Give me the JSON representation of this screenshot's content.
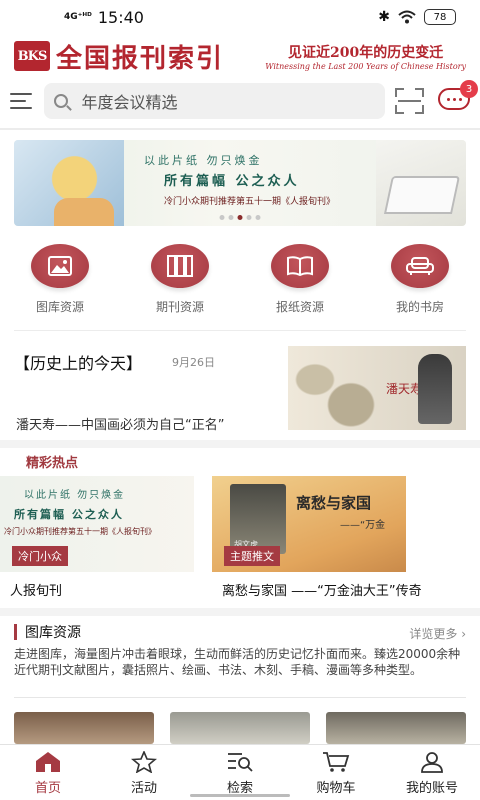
{
  "status_bar": {
    "network": "4G⁺ᴴᴰ",
    "time": "15:40",
    "battery": "78"
  },
  "header": {
    "logo_mark": "BKS",
    "title": "全国报刊索引",
    "slogan_main": "见证近200年的历史变迁",
    "slogan_sub": "Witnessing the Last 200 Years of Chinese History"
  },
  "search": {
    "placeholder": "年度会议精选",
    "message_badge": "3"
  },
  "banner": {
    "line1": "以此片纸   勿只焕金",
    "line2": "所有篇幅   公之众人",
    "line3": "冷门小众期刊推荐第五十一期《人报旬刊》",
    "active_slide": 3,
    "slide_count": 5
  },
  "categories": [
    {
      "label": "图库资源",
      "icon": "image-icon"
    },
    {
      "label": "期刊资源",
      "icon": "books-icon"
    },
    {
      "label": "报纸资源",
      "icon": "open-book-icon"
    },
    {
      "label": "我的书房",
      "icon": "sofa-icon"
    }
  ],
  "today": {
    "title": "【历史上的今天】",
    "date": "9月26日",
    "headline": "潘天寿——中国画必须为自己“正名”",
    "thumb_name": "潘天寿"
  },
  "hot": {
    "section_title": "精彩热点",
    "items": [
      {
        "tag": "冷门小众",
        "caption": "人报旬刊",
        "img_line1": "以此片纸   勿只焕金",
        "img_line2": "所有篇幅   公之众人",
        "img_line3": "冷门小众期刊推荐第五十一期《人报旬刊》"
      },
      {
        "tag": "主题推文",
        "caption": "离愁与家国 ——“万金油大王”传奇",
        "img_heading": "离愁与家国",
        "img_sub": "——“万金",
        "img_photo_caption": "胡文虎"
      }
    ]
  },
  "library": {
    "title": "图库资源",
    "more": "详览更多 ›",
    "desc": "走进图库，海量图片冲击着眼球，生动而鲜活的历史记忆扑面而来。臻选20000余种近代期刊文献图片，囊括照片、绘画、书法、木刻、手稿、漫画等多种类型。"
  },
  "bottom_nav": [
    {
      "label": "首页",
      "icon": "home-icon",
      "active": true
    },
    {
      "label": "活动",
      "icon": "star-icon",
      "active": false
    },
    {
      "label": "检索",
      "icon": "search-list-icon",
      "active": false
    },
    {
      "label": "购物车",
      "icon": "cart-icon",
      "active": false
    },
    {
      "label": "我的账号",
      "icon": "user-icon",
      "active": false
    }
  ],
  "colors": {
    "brand": "#a53a42",
    "badge": "#e43d4a"
  }
}
